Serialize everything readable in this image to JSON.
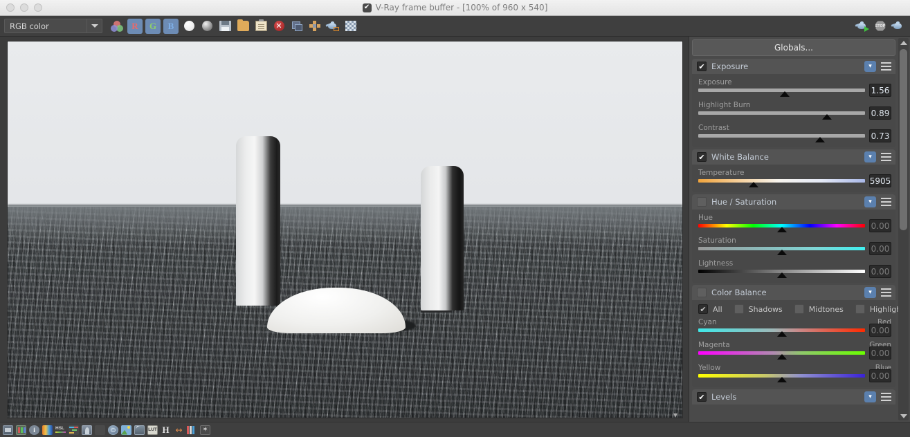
{
  "window": {
    "title": "V-Ray frame buffer - [100% of 960 x 540]",
    "logo_icon": "vray-logo-icon",
    "buttons": [
      "close",
      "minimize",
      "zoom"
    ]
  },
  "toolbar": {
    "channel_select": {
      "value": "RGB color",
      "placeholder": "RGB color"
    },
    "items": [
      {
        "name": "color-channels-icon",
        "label": "Color channels"
      },
      {
        "name": "red-channel-button",
        "label": "R",
        "active": true
      },
      {
        "name": "green-channel-button",
        "label": "G",
        "active": true
      },
      {
        "name": "blue-channel-button",
        "label": "B",
        "active": true
      },
      {
        "name": "alpha-white-button",
        "label": "Alpha"
      },
      {
        "name": "alpha-gradient-button",
        "label": "Monochrome"
      },
      {
        "name": "save-image-icon",
        "label": "Save image"
      },
      {
        "name": "open-image-icon",
        "label": "Load image"
      },
      {
        "name": "copy-clipboard-icon",
        "label": "Copy to clipboard"
      },
      {
        "name": "clear-image-icon",
        "label": "Clear image"
      },
      {
        "name": "resize-region-icon",
        "label": "Track mouse while rendering"
      },
      {
        "name": "pan-region-icon",
        "label": "Region render"
      },
      {
        "name": "render-last-icon",
        "label": "Render last"
      },
      {
        "name": "checker-background-icon",
        "label": "Show alpha checker"
      }
    ],
    "right_items": [
      {
        "name": "render-button",
        "label": "Start render"
      },
      {
        "name": "stop-render-button",
        "label": "Stop render"
      },
      {
        "name": "render-last-button",
        "label": "Render last"
      }
    ]
  },
  "canvas": {
    "expand_icon": "chevron-down-icon",
    "scene_description": "Rendered 3D scene: two white cylinders and a white dome over a dark rippled ocean surface"
  },
  "bottombar": {
    "items": [
      {
        "name": "background-image-icon",
        "label": "Background image"
      },
      {
        "name": "color-corrections-icon",
        "label": "Color corrections"
      },
      {
        "name": "info-icon",
        "label": "Info"
      },
      {
        "name": "exposure-icon",
        "label": "Exposure"
      },
      {
        "name": "hsl-icon",
        "label": "HSL"
      },
      {
        "name": "color-balance-icon",
        "label": "Color balance"
      },
      {
        "name": "levels-icon",
        "label": "Levels"
      },
      {
        "name": "curve-icon",
        "label": "Curve"
      },
      {
        "name": "lens-effects-icon",
        "label": "Lens effects"
      },
      {
        "name": "bloom-glare-icon",
        "label": "Bloom / Glare"
      },
      {
        "name": "curve-editor-icon",
        "label": "Curve editor"
      },
      {
        "name": "lut-icon",
        "label": "LUT"
      },
      {
        "name": "hue-icon",
        "label": "Hue"
      },
      {
        "name": "stereo-icon",
        "label": "Stereo"
      },
      {
        "name": "channels-icon",
        "label": "Channels"
      },
      {
        "name": "denoiser-icon",
        "label": "Denoiser"
      }
    ],
    "hsl_label": "HSL",
    "lut_label": "LUT",
    "hue_label": "H"
  },
  "panel": {
    "globals_label": "Globals...",
    "expand_icon": "double-chevron-down-icon",
    "menu_icon": "hamburger-menu-icon",
    "sections": [
      {
        "id": "exposure",
        "title": "Exposure",
        "enabled": true,
        "sliders": [
          {
            "label": "Exposure",
            "value": "1.56",
            "pos": 52,
            "dim": false
          },
          {
            "label": "Highlight Burn",
            "value": "0.89",
            "pos": 77,
            "dim": false
          },
          {
            "label": "Contrast",
            "value": "0.73",
            "pos": 73,
            "dim": false
          }
        ]
      },
      {
        "id": "white-balance",
        "title": "White Balance",
        "enabled": true,
        "sliders": [
          {
            "label": "Temperature",
            "value": "5905",
            "pos": 33,
            "dim": false,
            "gradient": "temp"
          }
        ]
      },
      {
        "id": "hue-saturation",
        "title": "Hue / Saturation",
        "enabled": false,
        "sliders": [
          {
            "label": "Hue",
            "value": "0.00",
            "pos": 50,
            "dim": true,
            "gradient": "hue"
          },
          {
            "label": "Saturation",
            "value": "0.00",
            "pos": 50,
            "dim": true,
            "gradient": "sat"
          },
          {
            "label": "Lightness",
            "value": "0.00",
            "pos": 50,
            "dim": true,
            "gradient": "light"
          }
        ]
      },
      {
        "id": "color-balance",
        "title": "Color Balance",
        "enabled": false,
        "range_options": [
          {
            "label": "All",
            "checked": true
          },
          {
            "label": "Shadows",
            "checked": false
          },
          {
            "label": "Midtones",
            "checked": false
          },
          {
            "label": "Highlights",
            "checked": false
          }
        ],
        "sliders": [
          {
            "label": "Cyan",
            "label_right": "Red",
            "value": "0.00",
            "pos": 50,
            "dim": true,
            "gradient": "cr"
          },
          {
            "label": "Magenta",
            "label_right": "Green",
            "value": "0.00",
            "pos": 50,
            "dim": true,
            "gradient": "mg"
          },
          {
            "label": "Yellow",
            "label_right": "Blue",
            "value": "0.00",
            "pos": 50,
            "dim": true,
            "gradient": "yb"
          }
        ]
      },
      {
        "id": "levels",
        "title": "Levels",
        "enabled": true,
        "sliders": []
      }
    ]
  },
  "colors": {
    "accent": "#5b80ae",
    "panel_bg": "#4a4a4a",
    "section_bg": "#484848",
    "toolbar_bg": "#3f3f3f",
    "value_text": "#dfe6ee"
  }
}
